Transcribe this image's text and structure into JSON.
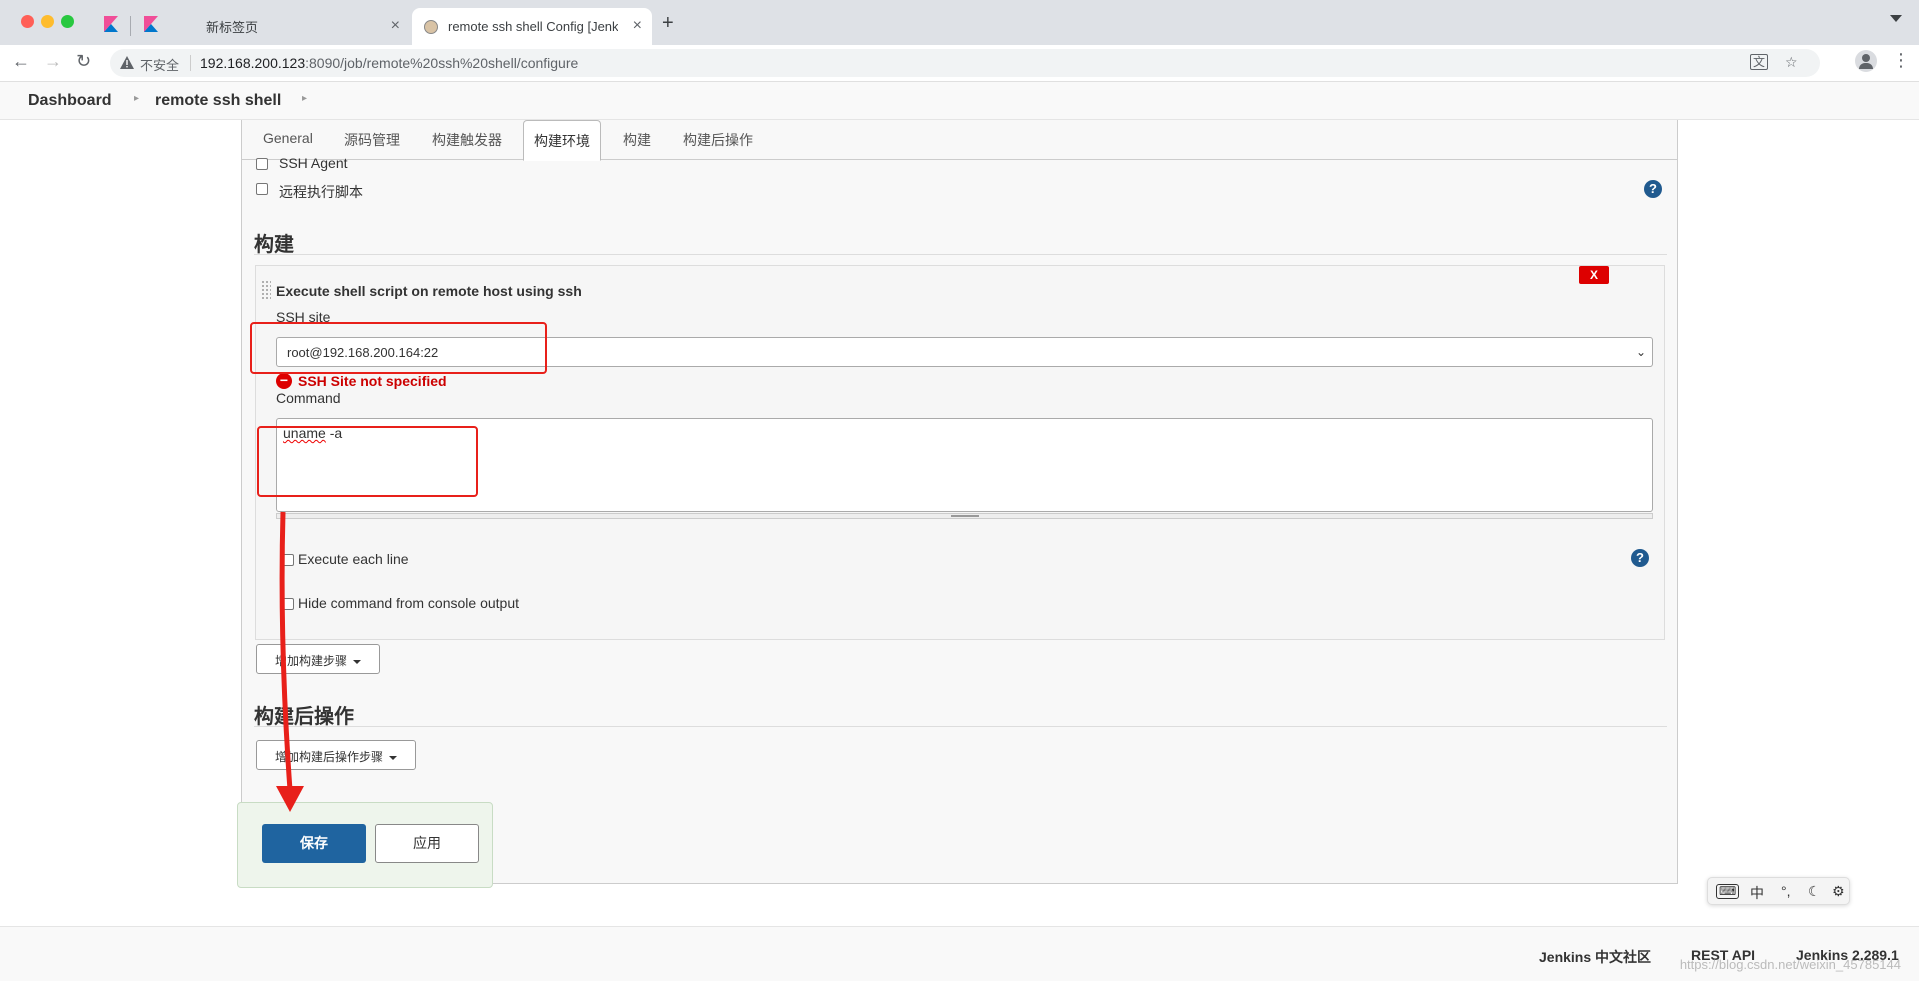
{
  "browser": {
    "tabs": [
      {
        "title": ""
      },
      {
        "title": ""
      },
      {
        "title": "新标签页"
      },
      {
        "title": "remote ssh shell Config [Jenkins]"
      }
    ],
    "new_tab": "+",
    "security_label": "不安全",
    "url_host": "192.168.200.123",
    "url_rest": ":8090/job/remote%20ssh%20shell/configure"
  },
  "breadcrumb": {
    "items": [
      "Dashboard",
      "remote ssh shell"
    ]
  },
  "config_tabs": [
    "General",
    "源码管理",
    "构建触发器",
    "构建环境",
    "构建",
    "构建后操作"
  ],
  "build_env": {
    "options": [
      "SSH Agent",
      "远程执行脚本"
    ]
  },
  "build_section": {
    "title": "构建",
    "step": {
      "title": "Execute shell script on remote host using ssh",
      "delete_label": "X",
      "ssh_site_label": "SSH site",
      "ssh_site_value": "root@192.168.200.164:22",
      "error": "SSH Site not specified",
      "command_label": "Command",
      "command_word": "uname",
      "command_rest": " -a",
      "execute_each_line": "Execute each line",
      "hide_command": "Hide command from console output"
    },
    "add_step_button": "增加构建步骤"
  },
  "post_build_section": {
    "title": "构建后操作",
    "add_step_button": "增加构建后操作步骤"
  },
  "actions": {
    "save": "保存",
    "apply": "应用"
  },
  "footer": {
    "links": [
      "Jenkins 中文社区",
      "REST API",
      "Jenkins 2.289.1"
    ],
    "watermark": "https://blog.csdn.net/weixin_45785144"
  },
  "ime": {
    "mode": "中"
  },
  "colors": {
    "primary_button": "#1f64a0",
    "error_red": "#cc0000",
    "annotation_red": "#e8201a",
    "help_blue": "#205a8f"
  }
}
